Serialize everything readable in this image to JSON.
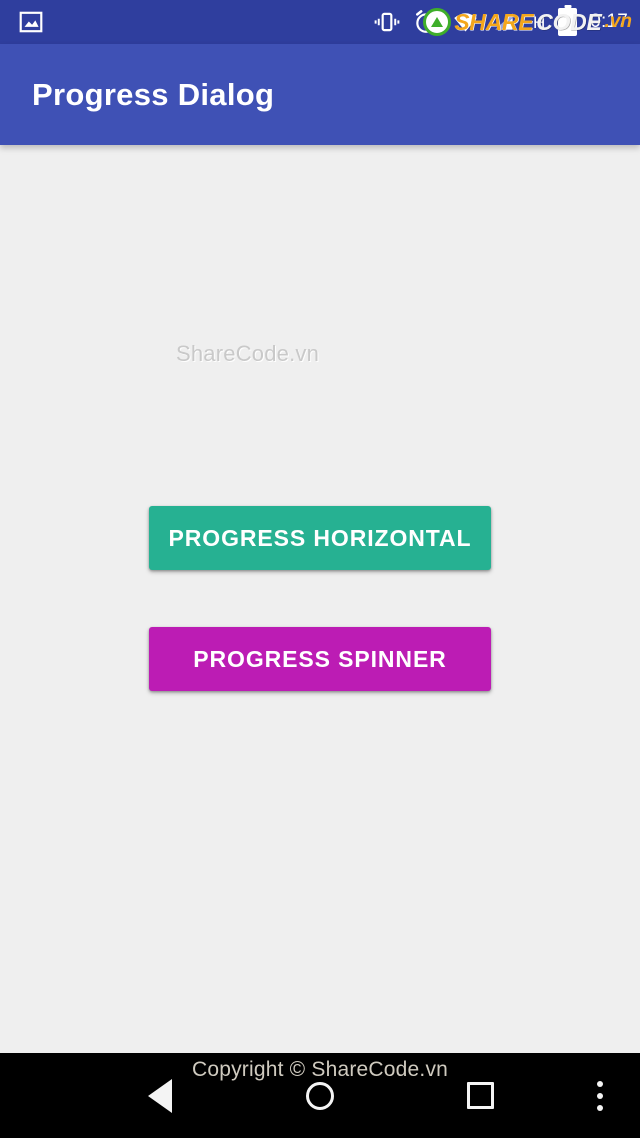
{
  "status_bar": {
    "background": "#2F3E9E",
    "notification_icons": [
      {
        "name": "image-notification-icon",
        "glyph": "photo"
      }
    ],
    "system_icons": [
      {
        "name": "vibrate-icon",
        "glyph": "vibrate"
      },
      {
        "name": "alarm-icon",
        "glyph": "alarm"
      },
      {
        "name": "wifi-icon",
        "glyph": "wifi"
      },
      {
        "name": "cellular-signal-icon",
        "glyph": "signal"
      }
    ],
    "network_type": "H",
    "clock": "0:17"
  },
  "watermark": {
    "logo_name": "sharecode-logo-icon",
    "part_share": "SHARE",
    "part_code": "CODE",
    "part_vn": ".vn",
    "center_text": "ShareCode.vn",
    "footer_text": "Copyright © ShareCode.vn"
  },
  "app_bar": {
    "title": "Progress Dialog",
    "background": "#3F51B5",
    "text_color": "#FFFFFF"
  },
  "content": {
    "background": "#EFEFEF",
    "buttons": [
      {
        "name": "progress-horizontal",
        "label": "PROGRESS HORIZONTAL",
        "color": "#26B192",
        "text_color": "#FFFFFF"
      },
      {
        "name": "progress-spinner",
        "label": "PROGRESS SPINNER",
        "color": "#BC1CB4",
        "text_color": "#FFFFFF"
      }
    ]
  },
  "nav_bar": {
    "background": "#000000",
    "buttons": [
      {
        "name": "back-button",
        "glyph": "triangle-left"
      },
      {
        "name": "home-button",
        "glyph": "circle"
      },
      {
        "name": "recents-button",
        "glyph": "square"
      },
      {
        "name": "overflow-button",
        "glyph": "three-dots"
      }
    ]
  }
}
